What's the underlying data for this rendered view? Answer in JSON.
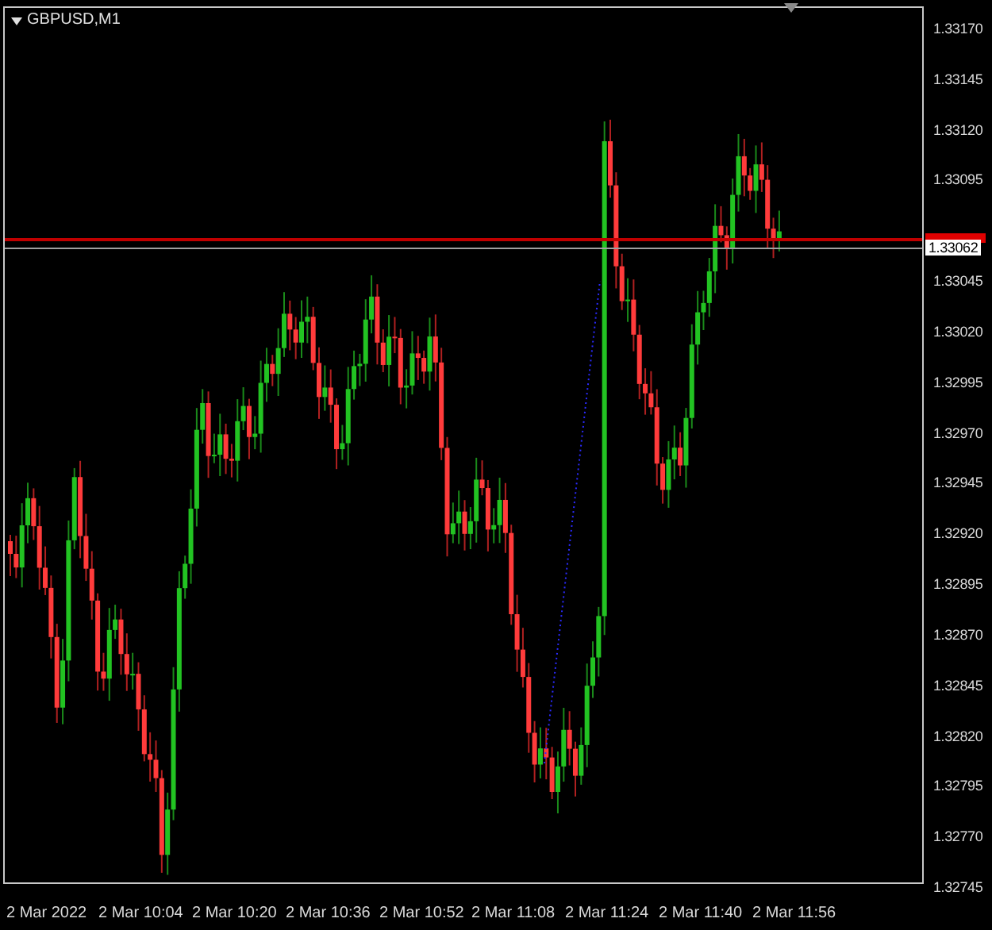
{
  "chart": {
    "symbol": "GBPUSD,M1",
    "y_axis_labels": [
      "1.33170",
      "1.33145",
      "1.33120",
      "1.33095",
      "1.33045",
      "1.33020",
      "1.32995",
      "1.32970",
      "1.32945",
      "1.32920",
      "1.32895",
      "1.32870",
      "1.32845",
      "1.32820",
      "1.32795",
      "1.32770",
      "1.32745"
    ],
    "bid_price_label": "1.33062",
    "x_axis_labels": [
      "2 Mar 2022",
      "2 Mar 10:04",
      "2 Mar 10:20",
      "2 Mar 10:36",
      "2 Mar 10:52",
      "2 Mar 11:08",
      "2 Mar 11:24",
      "2 Mar 11:40",
      "2 Mar 11:56"
    ]
  }
}
